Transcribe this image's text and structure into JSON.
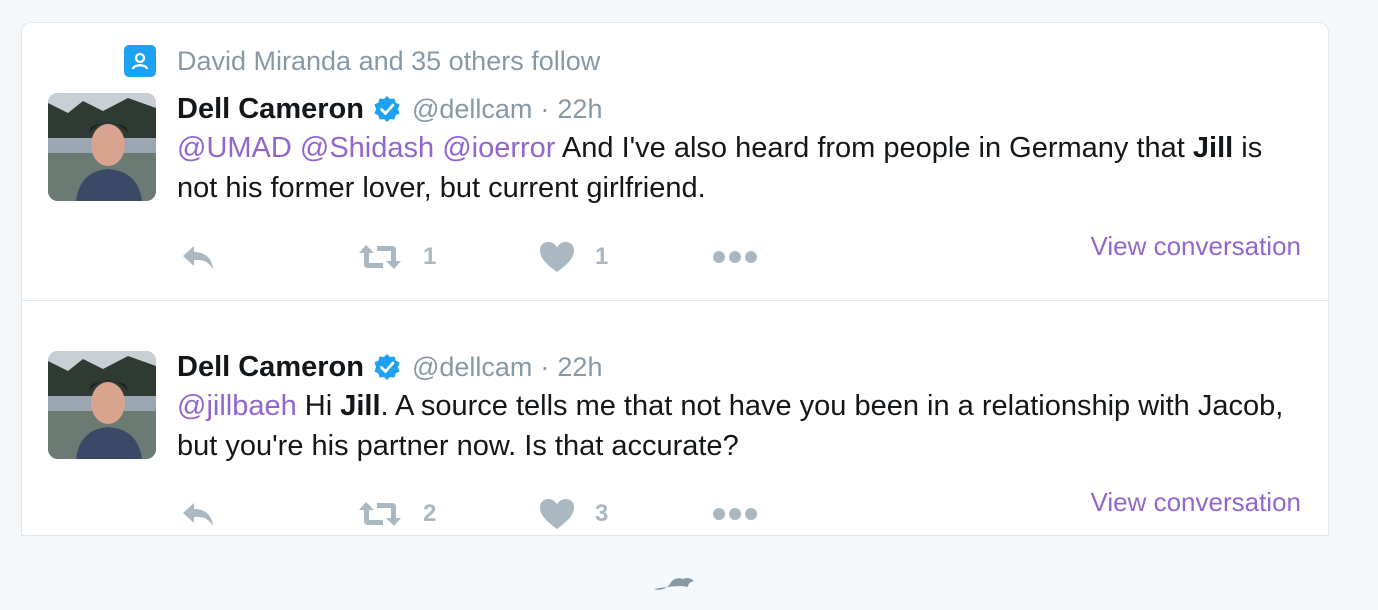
{
  "context": {
    "text": "David Miranda and 35 others follow",
    "icon": "person-follow-icon"
  },
  "colors": {
    "accent": "#1da1f2",
    "link": "#9266cc",
    "muted": "#8899a6",
    "action": "#aab8c2"
  },
  "tweets": [
    {
      "fullname": "Dell Cameron",
      "screen_name": "@dellcam",
      "separator": "·",
      "time": "22h",
      "text": {
        "m1": "@UMAD",
        "m2": "@Shidash",
        "m3": "@ioerror",
        "p1": " And I've also heard from people in Germany that ",
        "b1": "Jill",
        "p2": " is not his former lover, but current girlfriend."
      },
      "reply_count": "",
      "retweet_count": "1",
      "like_count": "1",
      "view_conversation": "View conversation"
    },
    {
      "fullname": "Dell Cameron",
      "screen_name": "@dellcam",
      "separator": "·",
      "time": "22h",
      "text": {
        "m1": "@jillbaeh",
        "p1": " Hi ",
        "b1": "Jill",
        "p2": ". A source tells me that not have you been in a relationship with Jacob, but you're his partner now. Is that accurate?"
      },
      "reply_count": "",
      "retweet_count": "2",
      "like_count": "3",
      "view_conversation": "View conversation"
    }
  ]
}
